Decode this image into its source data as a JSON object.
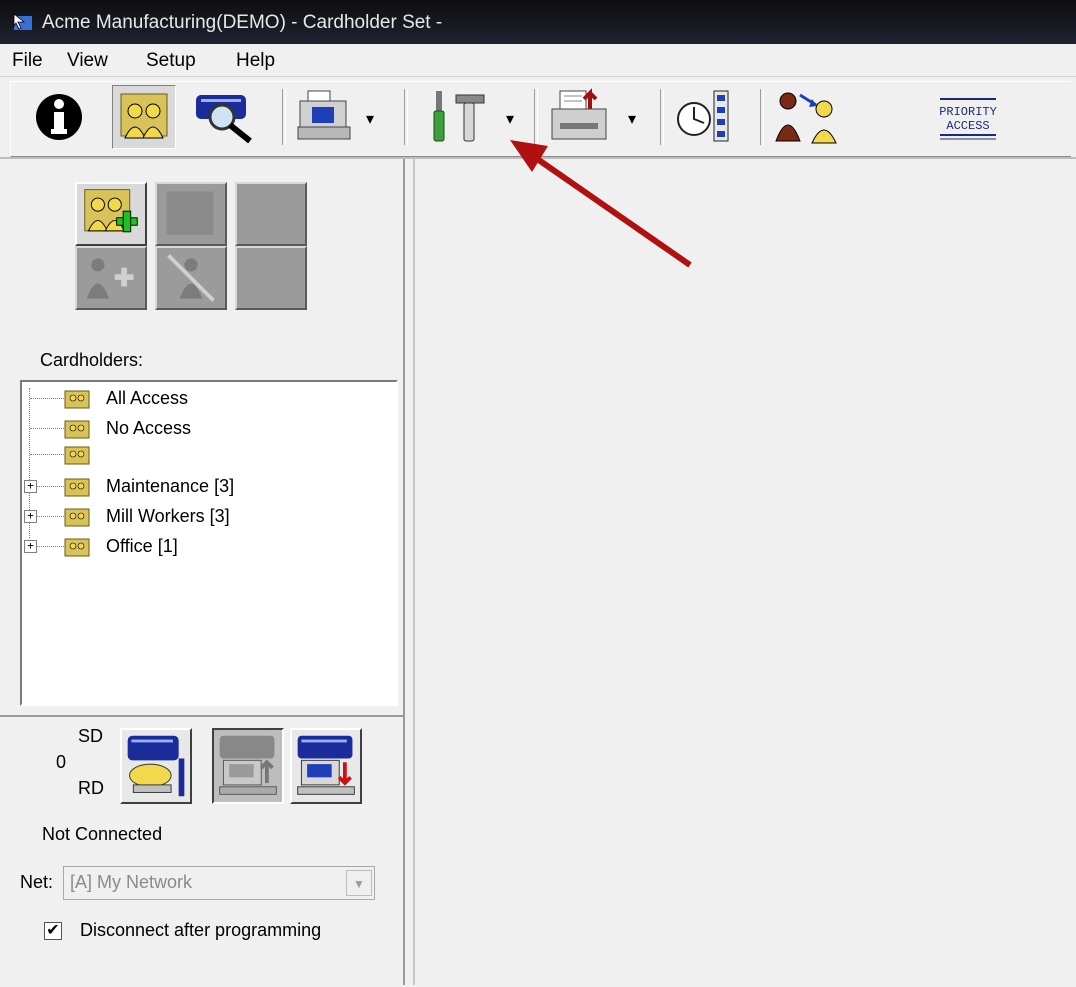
{
  "window": {
    "title": "Acme Manufacturing(DEMO) - Cardholder Set -"
  },
  "menu": {
    "items": [
      "File",
      "View",
      "Setup",
      "Help"
    ]
  },
  "toolbar": {
    "priority_access_label_line1": "PRIORITY",
    "priority_access_label_line2": "ACCESS",
    "dropdown_glyph": "▾"
  },
  "icons": {
    "info": "info-icon",
    "cardholders": "cardholders-icon",
    "controller": "controller-search-icon",
    "printer": "fax-terminal-icon",
    "tools": "tools-icon",
    "printer2": "printer-icon",
    "schedule": "schedule-icon",
    "transfer": "user-transfer-icon"
  },
  "left": {
    "cardholders_label": "Cardholders:",
    "tree": [
      {
        "label": "All Access",
        "expandable": false
      },
      {
        "label": "No Access",
        "expandable": false
      },
      {
        "label": "",
        "expandable": false
      },
      {
        "label": "Maintenance [3]",
        "expandable": true
      },
      {
        "label": "Mill Workers [3]",
        "expandable": true
      },
      {
        "label": "Office [1]",
        "expandable": true
      }
    ],
    "sd_label": "SD",
    "count_label": "0",
    "rd_label": "RD",
    "status": "Not Connected",
    "net_label": "Net:",
    "net_value": "[A] My Network",
    "disconnect_label": "Disconnect after programming",
    "disconnect_checked": "✔"
  },
  "colors": {
    "annotation_arrow": "#b01010",
    "folder": "#d8c25a"
  }
}
